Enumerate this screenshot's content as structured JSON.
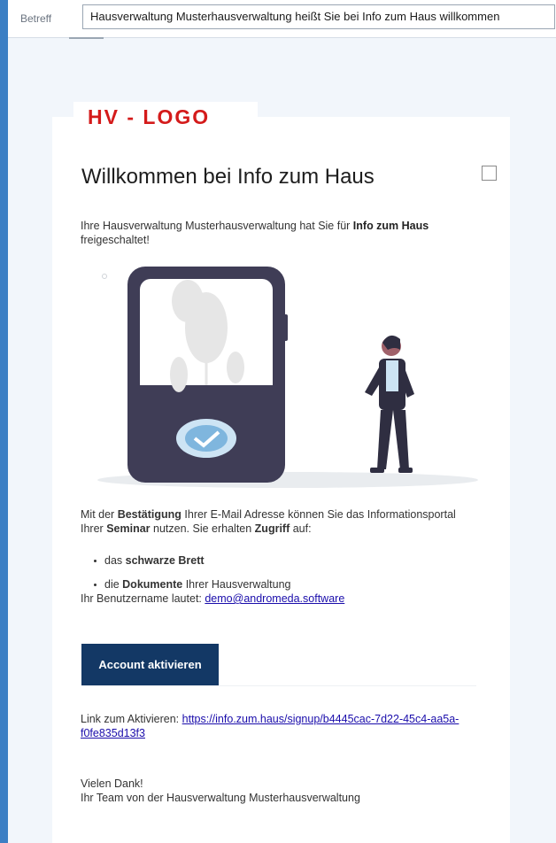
{
  "header": {
    "subject_label": "Betreff",
    "subject_value": "Hausverwaltung Musterhausverwaltung heißt Sie bei Info zum Haus willkommen"
  },
  "logo": {
    "text": "HV - LOGO"
  },
  "email": {
    "title": "Willkommen bei Info zum Haus",
    "intro_part1": "Ihre Hausverwaltung Musterhausverwaltung hat Sie für ",
    "intro_bold": "Info zum Haus",
    "intro_part2": " freigeschaltet!",
    "confirm_part1": "Mit der ",
    "confirm_bold1": "Bestätigung",
    "confirm_part2": " Ihrer E-Mail Adresse können Sie das Informationsportal Ihrer ",
    "confirm_bold2": "Seminar",
    "confirm_part3": " nutzen. Sie erhalten ",
    "confirm_bold3": "Zugriff",
    "confirm_part4": " auf:",
    "bullet1_pre": "das ",
    "bullet1_bold": "schwarze Brett",
    "bullet2_pre": "die ",
    "bullet2_bold": "Dokumente",
    "bullet2_post": " Ihrer Hausverwaltung",
    "username_label": "Ihr Benutzername lautet: ",
    "username_value": "demo@andromeda.software",
    "cta_label": "Account aktivieren",
    "link_label": "Link zum Aktivieren: ",
    "link_value": "https://info.zum.haus/signup/b4445cac-7d22-45c4-aa5a-f0fe835d13f3",
    "thanks": "Vielen Dank!",
    "signature": "Ihr Team von der Hausverwaltung Musterhausverwaltung"
  },
  "colors": {
    "accent_bar": "#3c7fc4",
    "logo_red": "#d41b1b",
    "cta_bg": "#133865",
    "link": "#1a0dab"
  }
}
